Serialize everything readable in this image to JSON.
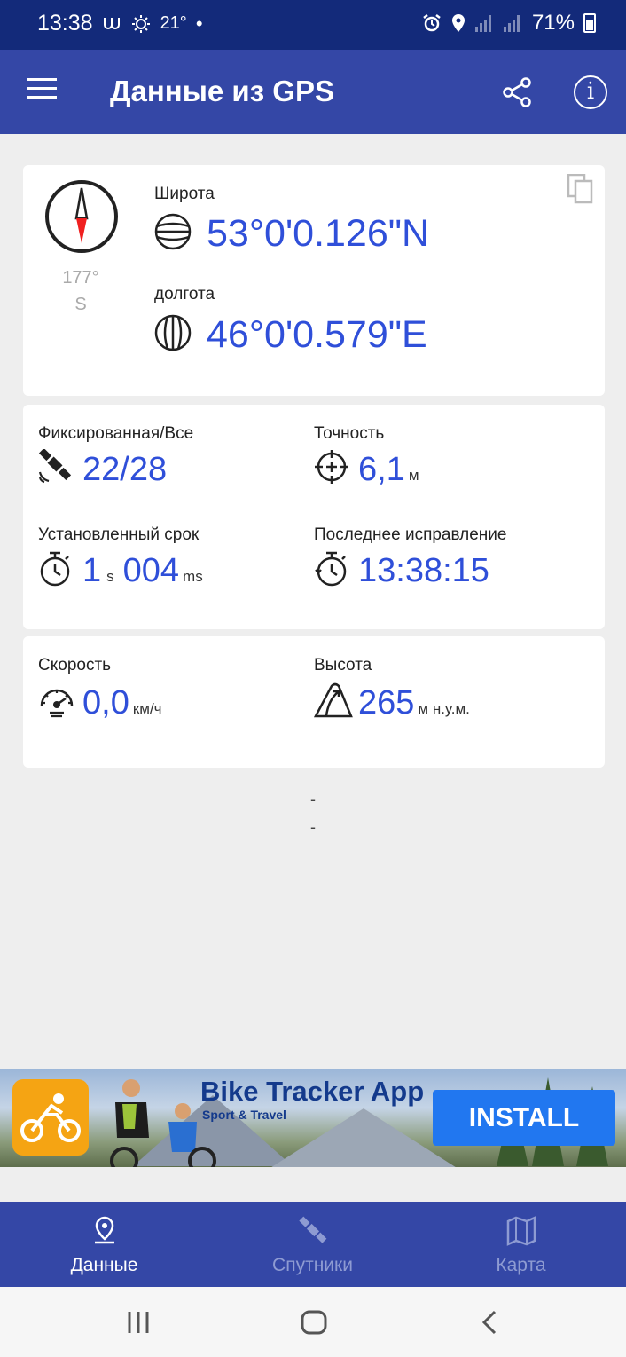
{
  "status_bar": {
    "time": "13:38",
    "temperature": "21°",
    "dot": "•",
    "battery": "71%"
  },
  "app_bar": {
    "title": "Данные из GPS"
  },
  "location": {
    "heading_degrees": "177°",
    "heading_direction": "S",
    "latitude_label": "Широта",
    "latitude_value": "53°0'0.126\"N",
    "longitude_label": "долгота",
    "longitude_value": "46°0'0.579\"E"
  },
  "satellites": {
    "fixed_label": "Фиксированная/Все",
    "fixed_value": "22/28",
    "accuracy_label": "Точность",
    "accuracy_value": "6,1",
    "accuracy_unit": "м",
    "ttff_label": "Установленный срок",
    "ttff_seconds": "1",
    "ttff_seconds_unit": "s",
    "ttff_ms": "004",
    "ttff_ms_unit": "ms",
    "last_fix_label": "Последнее исправление",
    "last_fix_value": "13:38:15"
  },
  "motion": {
    "speed_label": "Скорость",
    "speed_value": "0,0",
    "speed_unit": "км/ч",
    "altitude_label": "Высота",
    "altitude_value": "265",
    "altitude_unit": "м н.у.м."
  },
  "extra": {
    "line1": "-",
    "line2": "-"
  },
  "ad": {
    "title": "Bike Tracker App",
    "subtitle": "Sport & Travel",
    "install": "INSTALL"
  },
  "bottom_nav": {
    "items": [
      {
        "label": "Данные",
        "active": true
      },
      {
        "label": "Спутники",
        "active": false
      },
      {
        "label": "Карта",
        "active": false
      }
    ]
  },
  "colors": {
    "status_bar": "#132a7a",
    "app_bar": "#3447a6",
    "value_blue": "#2f4fd9",
    "install_blue": "#2177f0"
  }
}
